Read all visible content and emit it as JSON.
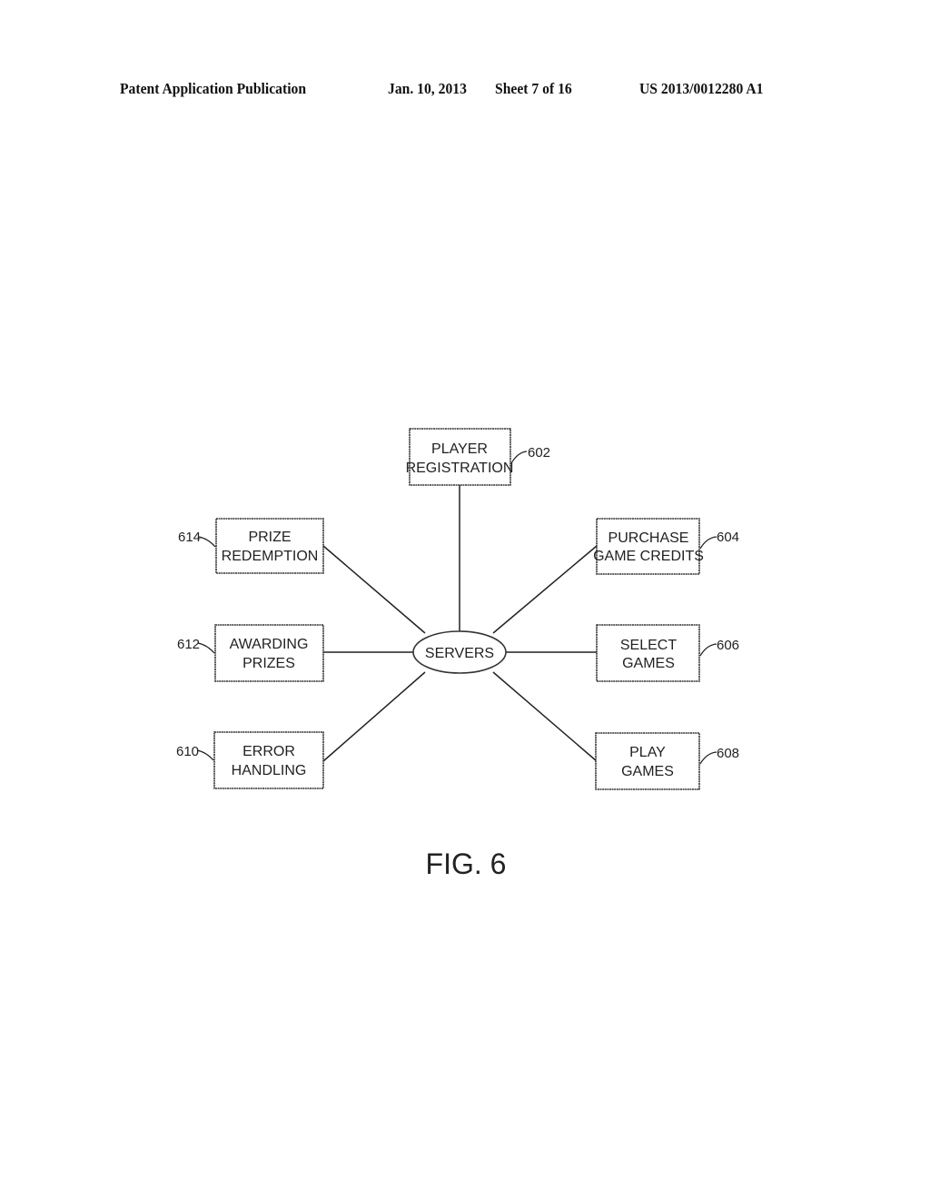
{
  "header": {
    "publication": "Patent Application Publication",
    "date": "Jan. 10, 2013",
    "sheet": "Sheet 7 of 16",
    "patent_number": "US 2013/0012280 A1"
  },
  "diagram": {
    "center": {
      "label": "SERVERS"
    },
    "nodes": [
      {
        "id": "602",
        "line1": "PLAYER",
        "line2": "REGISTRATION"
      },
      {
        "id": "604",
        "line1": "PURCHASE",
        "line2": "GAME CREDITS"
      },
      {
        "id": "606",
        "line1": "SELECT",
        "line2": "GAMES"
      },
      {
        "id": "608",
        "line1": "PLAY",
        "line2": "GAMES"
      },
      {
        "id": "610",
        "line1": "ERROR",
        "line2": "HANDLING"
      },
      {
        "id": "612",
        "line1": "AWARDING",
        "line2": "PRIZES"
      },
      {
        "id": "614",
        "line1": "PRIZE",
        "line2": "REDEMPTION"
      }
    ],
    "figure_label": "FIG. 6"
  }
}
